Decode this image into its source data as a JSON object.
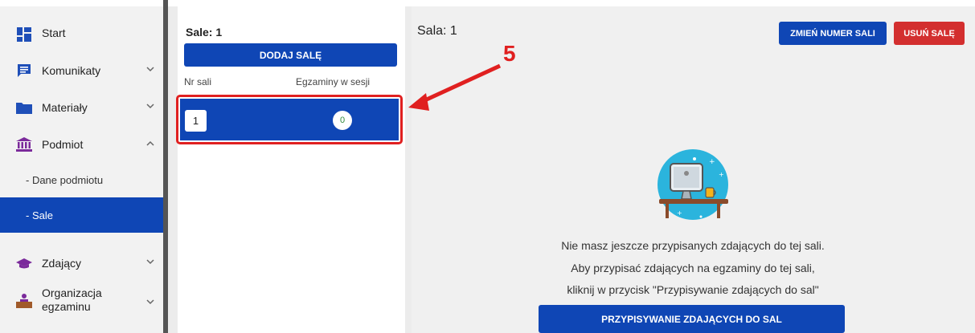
{
  "sidebar": {
    "items": [
      {
        "label": "Start",
        "icon": "dashboard-icon",
        "chevron": ""
      },
      {
        "label": "Komunikaty",
        "icon": "message-icon",
        "chevron": "⌄"
      },
      {
        "label": "Materiały",
        "icon": "folder-icon",
        "chevron": "⌄"
      },
      {
        "label": "Podmiot",
        "icon": "institution-icon",
        "chevron": "⌃"
      },
      {
        "label": "Zdający",
        "icon": "graduation-cap-icon",
        "chevron": "⌄"
      },
      {
        "label": "Organizacja egzaminu",
        "icon": "person-desk-icon",
        "chevron": "⌄"
      }
    ],
    "subitems": [
      {
        "label": "- Dane podmiotu"
      },
      {
        "label": "- Sale"
      }
    ],
    "accent": "#0f46b5",
    "icon_color": "#1f4fb8",
    "podmiot_icon_color": "#7b2a9b",
    "zdajacy_icon_color": "#7b2a9b"
  },
  "rooms": {
    "title": "Sale: 1",
    "add_button": "DODAJ SALĘ",
    "col_room": "Nr sali",
    "col_exams": "Egzaminy w sesji",
    "rows": [
      {
        "room": "1",
        "exams": "0"
      }
    ]
  },
  "detail": {
    "title": "Sala: 1",
    "rename_button": "ZMIEŃ NUMER SALI",
    "delete_button": "USUŃ SALĘ",
    "message_line1": "Nie masz jeszcze przypisanych zdających do tej sali.",
    "message_line2": "Aby przypisać zdających na egzaminy do tej sali,",
    "message_line3": "kliknij w przycisk \"Przypisywanie zdających do sal\"",
    "assign_button": "PRZYPISYWANIE ZDAJĄCYCH DO SAL",
    "danger_color": "#d32f2f"
  },
  "annotation": {
    "number": "5",
    "color": "#e02020"
  }
}
